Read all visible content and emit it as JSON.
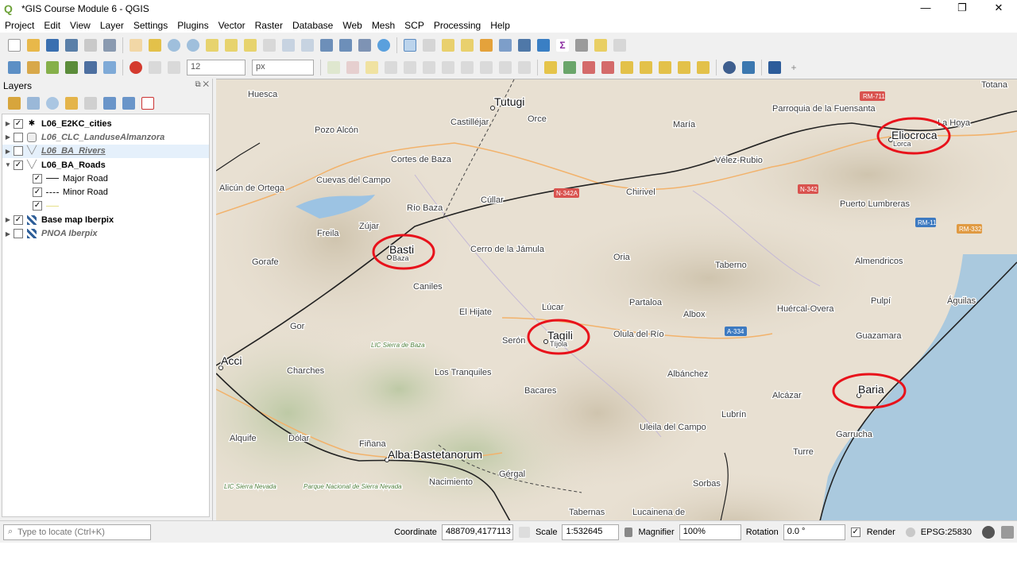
{
  "window": {
    "title": "*GIS Course Module 6 - QGIS",
    "controls": [
      "—",
      "❐",
      "✕"
    ]
  },
  "menu": [
    "Project",
    "Edit",
    "View",
    "Layer",
    "Settings",
    "Plugins",
    "Vector",
    "Raster",
    "Database",
    "Web",
    "Mesh",
    "SCP",
    "Processing",
    "Help"
  ],
  "toolbar2": {
    "size_value": "12",
    "unit": "px"
  },
  "layers_panel": {
    "title": "Layers",
    "items": [
      {
        "name": "L06_E2KC_cities",
        "checked": true,
        "bold": true,
        "italic": false,
        "expand": "▶"
      },
      {
        "name": "L06_CLC_LanduseAlmanzora",
        "checked": false,
        "bold": false,
        "italic": true,
        "expand": "▶"
      },
      {
        "name": "L06_BA_Rivers",
        "checked": false,
        "bold": false,
        "italic": true,
        "expand": "▶"
      },
      {
        "name": "L06_BA_Roads",
        "checked": true,
        "bold": true,
        "italic": false,
        "expand": "▼"
      },
      {
        "name": "Major Road",
        "checked": true,
        "child": true
      },
      {
        "name": "Minor Road",
        "checked": true,
        "child": true
      },
      {
        "name": "",
        "checked": true,
        "child": true
      },
      {
        "name": "Base map Iberpix",
        "checked": true,
        "bold": true,
        "italic": false,
        "expand": "▶"
      },
      {
        "name": "PNOA Iberpix",
        "checked": false,
        "bold": true,
        "italic": true,
        "expand": "▶"
      }
    ]
  },
  "map": {
    "highlighted_cities": [
      {
        "name": "Basti",
        "sub": "Baza"
      },
      {
        "name": "Eliocroca",
        "sub": "Lorca"
      },
      {
        "name": "Tagili",
        "sub": "Tíjola"
      },
      {
        "name": "Baria",
        "sub": ""
      }
    ],
    "other_cities": [
      "Tutugi",
      "Acci",
      "Alba:Bastetanorum"
    ],
    "place_labels": [
      "Huesca",
      "Pozo Alcón",
      "Castilléjar",
      "Orce",
      "María",
      "Parroquia de la Fuensanta",
      "La Hoya",
      "Totana",
      "Cortes de Baza",
      "Vélez-Rubio",
      "Alicún de Ortega",
      "Cuevas del Campo",
      "Cúllar",
      "Chirivel",
      "Puerto Lumbreras",
      "Freila",
      "Zújar",
      "Río Baza",
      "Cerro de la Jámula",
      "Oria",
      "Taberno",
      "Almendricos",
      "Gorafe",
      "Caniles",
      "Partaloa",
      "Pulpí",
      "Águilas",
      "Huércal-Overa",
      "El Hijate",
      "Lúcar",
      "Albox",
      "Gor",
      "Serón",
      "Olula del Río",
      "Guazamara",
      "LIC Sierra de Baza",
      "Charches",
      "Los Tranquiles",
      "Albánchez",
      "Bacares",
      "Alquife",
      "Dólar",
      "Fiñana",
      "Lubrín",
      "Uleila del Campo",
      "Garrucha",
      "Turre",
      "Alcázar",
      "Nacimiento",
      "Gérgal",
      "LIC Sierra Nevada",
      "Parque Nacional de Sierra Nevada",
      "Sorbas",
      "Tabernas",
      "Lucainena de"
    ],
    "road_labels": [
      "RM-711",
      "N-342A",
      "N-342",
      "RM-11",
      "RM-332",
      "A-334"
    ]
  },
  "statusbar": {
    "locator_placeholder": "Type to locate (Ctrl+K)",
    "coordinate_label": "Coordinate",
    "coordinate_value": "488709,4177113",
    "scale_label": "Scale",
    "scale_value": "1:532645",
    "magnifier_label": "Magnifier",
    "magnifier_value": "100%",
    "rotation_label": "Rotation",
    "rotation_value": "0.0 °",
    "render_label": "Render",
    "crs": "EPSG:25830"
  },
  "colors": {
    "highlight_circle": "#e8121b",
    "major_road": "#222222",
    "sea": "#aac9de"
  }
}
